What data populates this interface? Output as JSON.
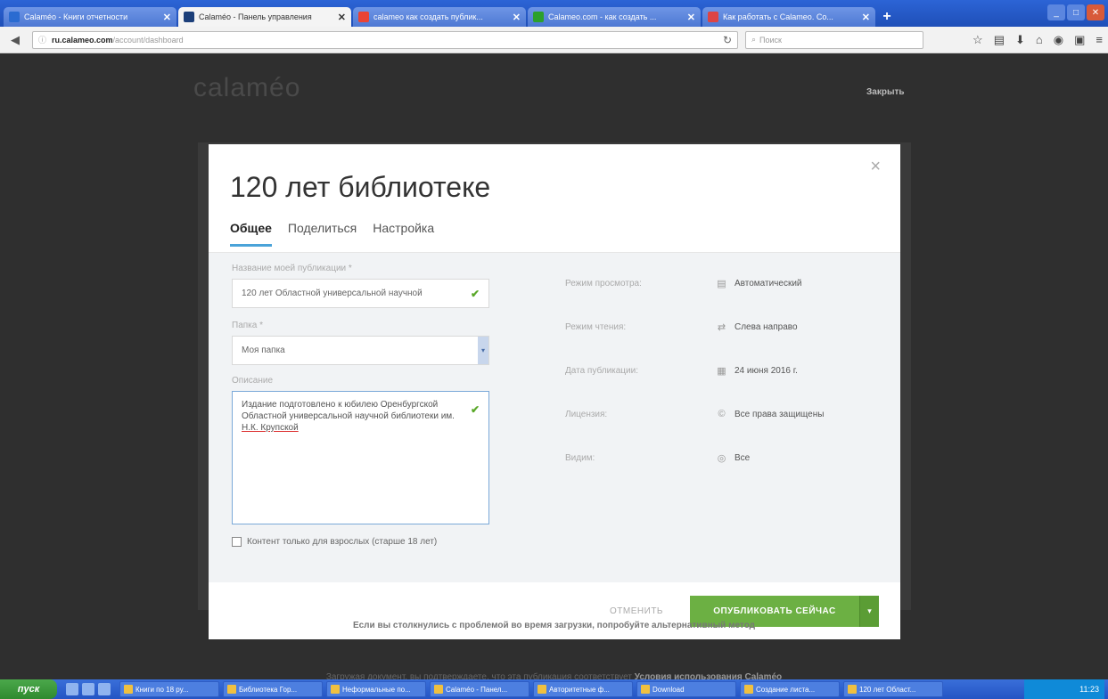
{
  "browser": {
    "tabs": [
      {
        "title": "Calaméo - Книги отчетности",
        "color": "#2a6bd1",
        "active": false
      },
      {
        "title": "Calaméo - Панель управления",
        "color": "#1c3f7a",
        "active": true
      },
      {
        "title": "calameo как создать публик...",
        "color": "#e94335",
        "active": false
      },
      {
        "title": "Calameo.com - как создать ...",
        "color": "#2ca02c",
        "active": false
      },
      {
        "title": "Как работать с Calameo. Со...",
        "color": "#d44",
        "active": false
      }
    ],
    "url_host": "ru.calameo.com",
    "url_path": "/account/dashboard",
    "search_placeholder": "Поиск"
  },
  "page": {
    "logo": "calaméo",
    "close_link": "Закрыть",
    "hint": "Если вы столкнулись с проблемой во время загрузки, попробуйте альтернативный метод",
    "terms_text": "Загружая документ, вы подтверждаете, что эта публикация соответствует",
    "terms_link": "Условия использования Calaméo"
  },
  "modal": {
    "title": "120 лет библиотеке",
    "tabs": [
      "Общее",
      "Поделиться",
      "Настройка"
    ],
    "fields": {
      "name_label": "Название моей публикации *",
      "name_value": "120 лет Областной универсальной научной",
      "folder_label": "Папка *",
      "folder_value": "Моя папка",
      "description_label": "Описание",
      "description_value": "Издание подготовлено к юбилею Оренбургской Областной универсальной научной библиотеки им.",
      "description_name": "Н.К. Крупской",
      "adult_label": "Контент только для взрослых (старше 18 лет)"
    },
    "meta": [
      {
        "key": "Режим просмотра:",
        "icon": "view-mode-icon",
        "value": "Автоматический"
      },
      {
        "key": "Режим чтения:",
        "icon": "reading-mode-icon",
        "value": "Слева направо"
      },
      {
        "key": "Дата публикации:",
        "icon": "calendar-icon",
        "value": "24 июня 2016 г."
      },
      {
        "key": "Лицензия:",
        "icon": "license-icon",
        "value": "Все права защищены"
      },
      {
        "key": "Видим:",
        "icon": "visibility-icon",
        "value": "Все"
      }
    ],
    "cancel_label": "ОТМЕНИТЬ",
    "publish_label": "ОПУБЛИКОВАТЬ СЕЙЧАС"
  },
  "taskbar": {
    "start_label": "пуск",
    "items": [
      "Книги по 18 ру...",
      "Библиотека Гор...",
      "Неформальные по...",
      "Calaméo - Панел...",
      "Авторитетные ф...",
      "Download",
      "Создание листа...",
      "120 лет Област..."
    ],
    "clock": "11:23"
  }
}
